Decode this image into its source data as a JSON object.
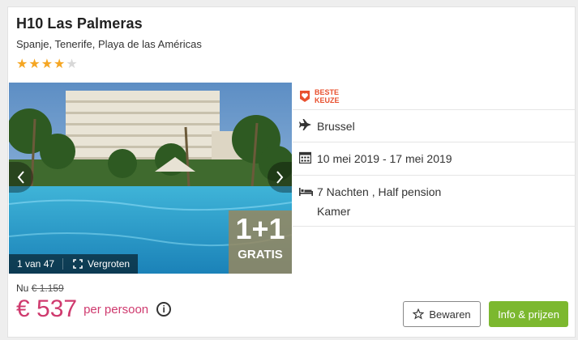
{
  "hotel": {
    "name": "H10 Las Palmeras",
    "location": "Spanje, Tenerife, Playa de las Américas",
    "stars_filled": 4,
    "stars_total": 5
  },
  "gallery": {
    "counter": "1 van 47",
    "zoom_label": "Vergroten",
    "promo_big": "1+1",
    "promo_small": "GRATIS"
  },
  "details": {
    "badge_line1": "BESTE",
    "badge_line2": "KEUZE",
    "departure": "Brussel",
    "dates": "10 mei 2019 - 17 mei 2019",
    "stay": "7 Nachten , Half pension",
    "room": "Kamer"
  },
  "pricing": {
    "was_prefix": "Nu",
    "was_price": "€ 1.159",
    "price": "€ 537",
    "per_person": "per persoon"
  },
  "actions": {
    "save_label": "Bewaren",
    "info_label": "Info & prijzen"
  },
  "colors": {
    "accent_price": "#cf3a6e",
    "primary_button": "#7cb82f",
    "star": "#f5a623",
    "badge": "#e8502e"
  }
}
